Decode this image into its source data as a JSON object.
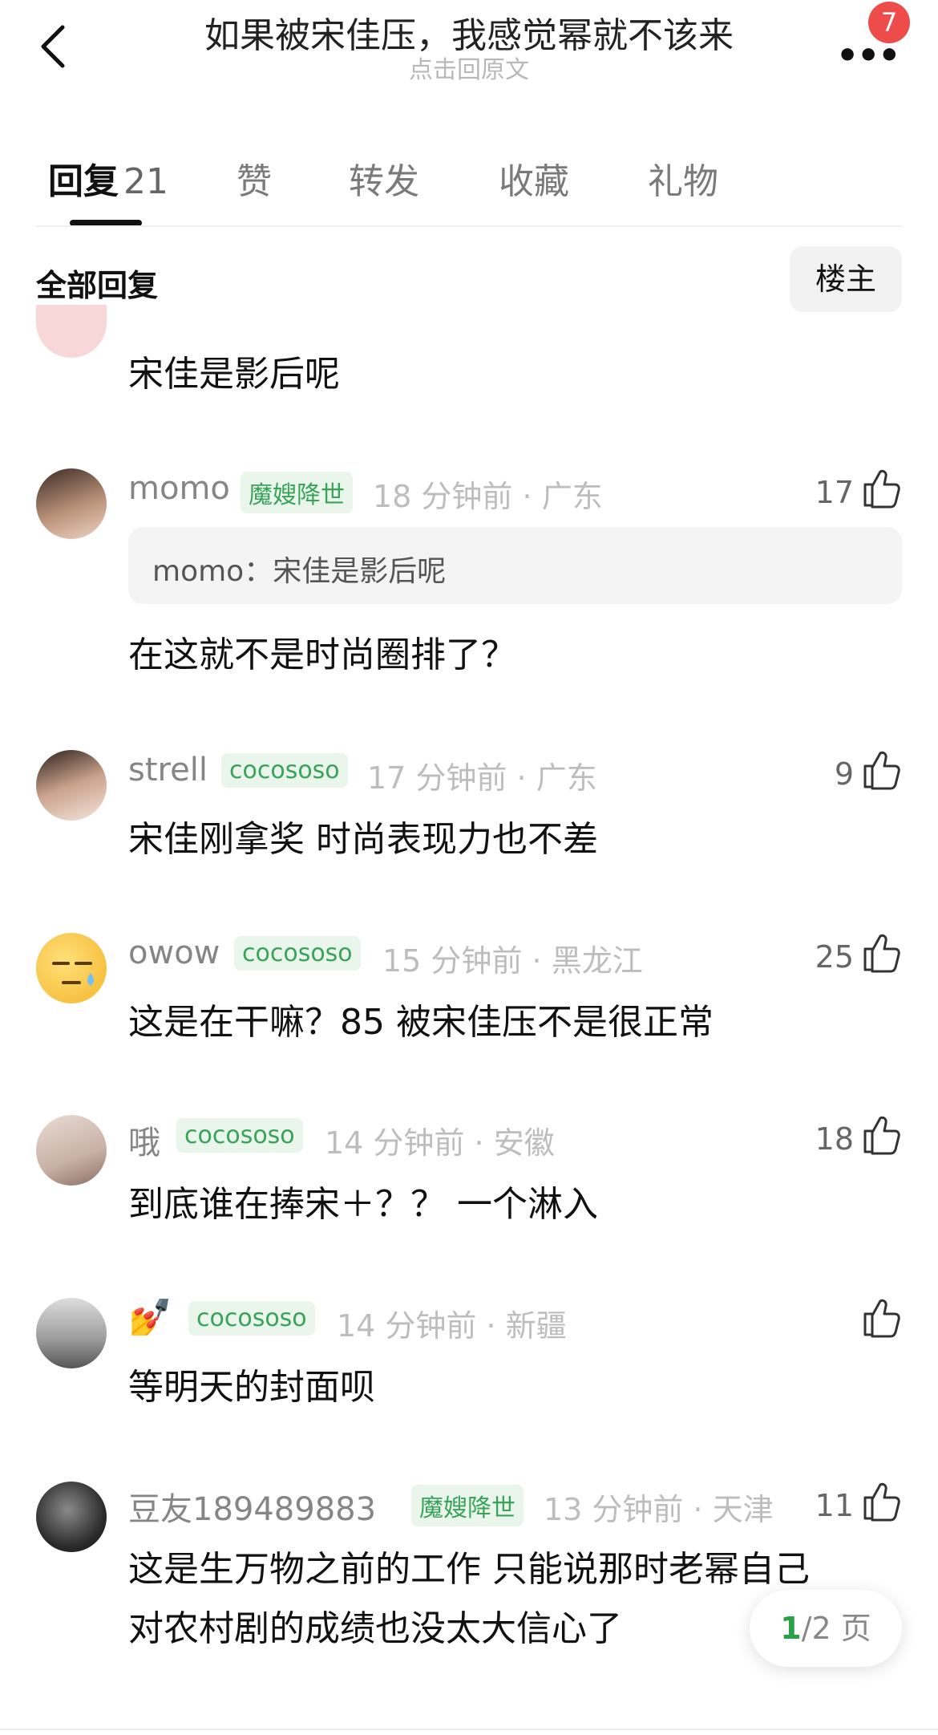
{
  "header": {
    "title": "如果被宋佳压，我感觉幂就不该来",
    "subtitle": "点击回原文",
    "more_icon": "ellipsis-icon",
    "notification_count": "7"
  },
  "tabs": [
    {
      "label": "回复",
      "count": "21",
      "active": true
    },
    {
      "label": "赞"
    },
    {
      "label": "转发"
    },
    {
      "label": "收藏"
    },
    {
      "label": "礼物"
    }
  ],
  "filter": {
    "label": "全部回复",
    "op_button": "楼主"
  },
  "comments": [
    {
      "content": "宋佳是影后呢"
    },
    {
      "name": "momo",
      "tag": "魔嫂降世",
      "time": "18 分钟前",
      "location": "广东",
      "likes": "17",
      "quote": "momo：宋佳是影后呢",
      "content": "在这就不是时尚圈排了？"
    },
    {
      "name": "strell",
      "tag": "cocososo",
      "time": "17 分钟前",
      "location": "广东",
      "likes": "9",
      "content": "宋佳刚拿奖 时尚表现力也不差"
    },
    {
      "name": "owow",
      "tag": "cocososo",
      "time": "15 分钟前",
      "location": "黑龙江",
      "likes": "25",
      "content": "这是在干嘛？85 被宋佳压不是很正常"
    },
    {
      "name": "哦",
      "tag": "cocososo",
      "time": "14 分钟前",
      "location": "安徽",
      "likes": "18",
      "content": "到底谁在捧宋＋？？ 一个淋入"
    },
    {
      "name": "💅",
      "tag": "cocososo",
      "time": "14 分钟前",
      "location": "新疆",
      "likes": "",
      "content": "等明天的封面呗"
    },
    {
      "name": "豆友189489883",
      "tag": "魔嫂降世",
      "time": "13 分钟前",
      "location": "天津",
      "likes": "11",
      "content_lines": [
        "这是生万物之前的工作 只能说那时老幂自己",
        "对农村剧的成绩也没太大信心了"
      ]
    }
  ],
  "pager": {
    "current": "1",
    "total": "/2 页"
  },
  "colors": {
    "tag_green": "#3aa35a",
    "badge_red": "#ee4b4b"
  }
}
